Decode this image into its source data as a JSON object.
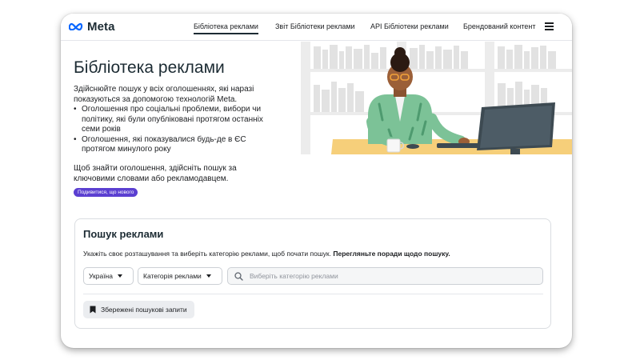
{
  "nav": {
    "brand": "Meta",
    "items": [
      {
        "label": "Бібліотека реклами",
        "active": true
      },
      {
        "label": "Звіт Бібліотеки реклами",
        "active": false
      },
      {
        "label": "API Бібліотеки реклами",
        "active": false
      },
      {
        "label": "Брендований контент",
        "active": false
      }
    ],
    "menu_icon": "hamburger-menu-icon"
  },
  "hero": {
    "title": "Бібліотека реклами",
    "description": "Здійснюйте пошук у всіх оголошеннях, які наразі показуються за допомогою технологій Meta.",
    "bullets": [
      "Оголошення про соціальні проблеми, вибори чи політику, які були опубліковані протягом останніх семи років",
      "Оголошення, які показувалися будь-де в ЄС протягом минулого року"
    ],
    "hint": "Щоб знайти оголошення, здійсніть пошук за ключовими словами або рекламодавцем.",
    "badge": "Подивитися, що нового"
  },
  "search": {
    "title": "Пошук реклами",
    "description": "Укажіть своє розташування та виберіть категорію реклами, щоб почати пошук.",
    "tips_link": "Перегляньте поради щодо пошуку.",
    "country": "Україна",
    "category": "Категорія реклами",
    "placeholder": "Виберіть категорію реклами",
    "saved_label": "Збережені пошукові запити"
  },
  "colors": {
    "accent": "#5b3fd1",
    "brand_blue": "#0866ff",
    "text": "#1c1e21",
    "desk": "#f6cf7a",
    "shirt": "#7cc297"
  }
}
